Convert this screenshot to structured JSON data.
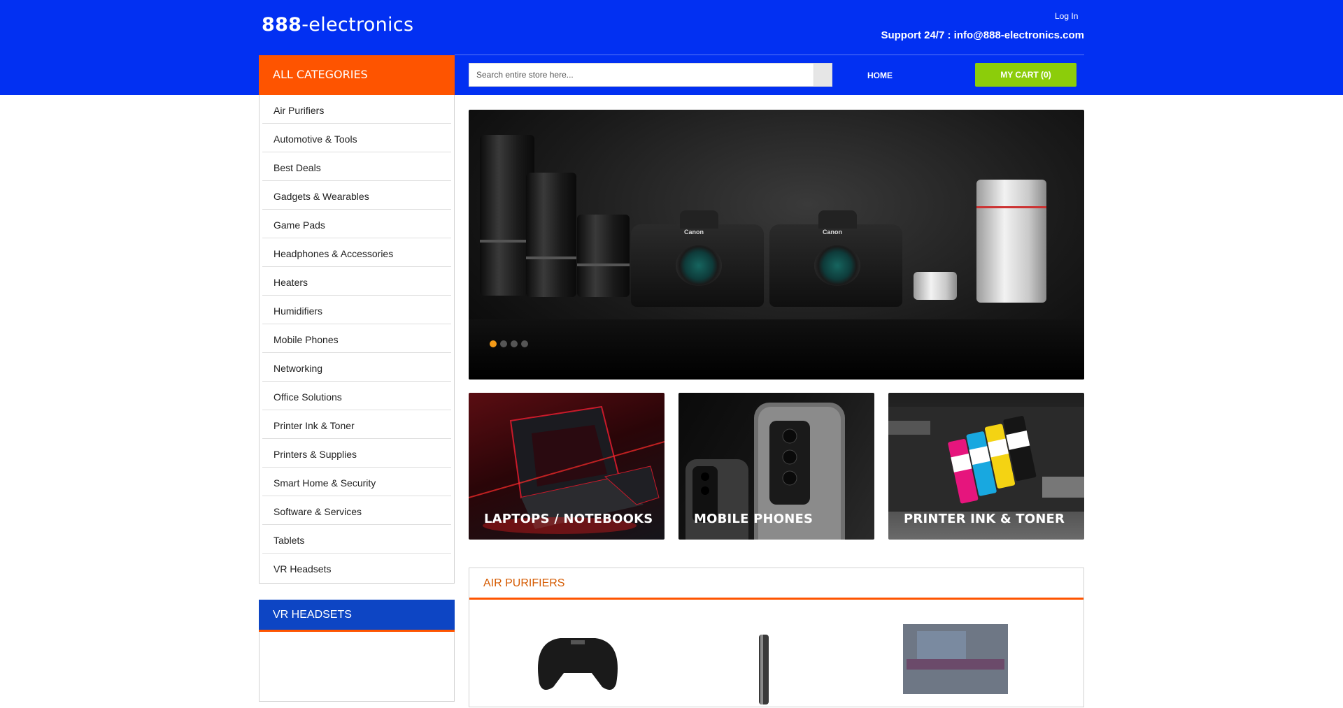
{
  "header": {
    "logo_bold": "888",
    "logo_rest": "-electronics",
    "login_label": "Log In",
    "support_text": "Support 24/7 : info@888-electronics.com",
    "all_categories_label": "ALL CATEGORIES",
    "search_placeholder": "Search entire store here...",
    "home_label": "HOME",
    "cart_label": "MY CART (0)"
  },
  "sidebar": {
    "categories": [
      "Air Purifiers",
      "Automotive & Tools",
      "Best Deals",
      "Gadgets & Wearables",
      "Game Pads",
      "Headphones & Accessories",
      "Heaters",
      "Humidifiers",
      "Mobile Phones",
      "Networking",
      "Office Solutions",
      "Printer Ink & Toner",
      "Printers & Supplies",
      "Smart Home & Security",
      "Software & Services",
      "Tablets",
      "VR Headsets"
    ],
    "vr_box_title": "VR HEADSETS"
  },
  "slider": {
    "slide_count": 4,
    "active_slide": 1,
    "brand_text": "Canon",
    "dot_active_color": "#f39a17"
  },
  "tiles": [
    {
      "caption": "LAPTOPS / NOTEBOOKS"
    },
    {
      "caption": "MOBILE PHONES"
    },
    {
      "caption": "PRINTER INK & TONER"
    }
  ],
  "section": {
    "title": "AIR PURIFIERS"
  },
  "colors": {
    "brand_blue": "#0230f2",
    "accent_orange": "#fe5400",
    "cart_green": "#8ccd0a",
    "vr_blue": "#0d45c4"
  }
}
